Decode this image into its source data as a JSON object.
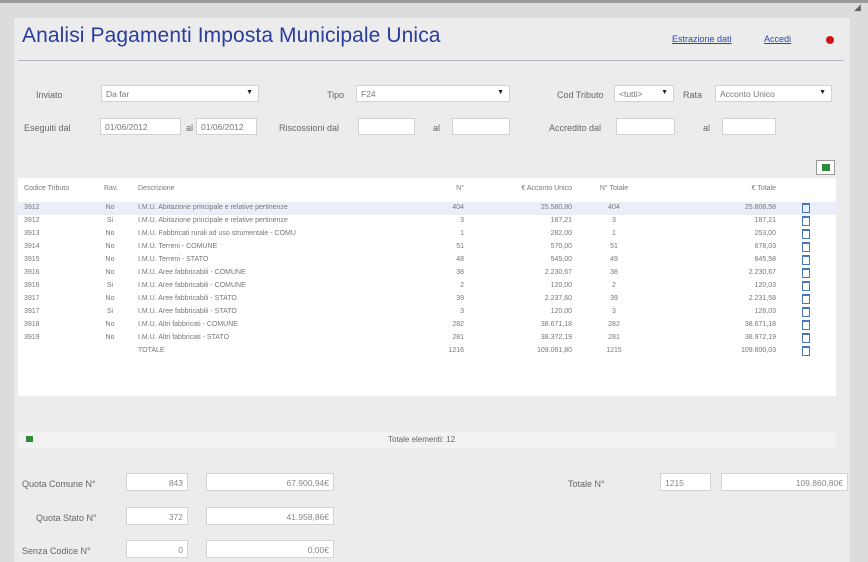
{
  "title": "Analisi Pagamenti Imposta Municipale Unica",
  "links": {
    "extract": "Estrazione dati",
    "back": "Accedi"
  },
  "filters": {
    "invento_label": "Inviato",
    "invento_value": "Da far",
    "tipo_label": "Tipo",
    "tipo_value": "F24",
    "cod_tributo_label": "Cod Tributo",
    "cod_tributo_value": "<tutti>",
    "rata_label": "Rata",
    "rata_value": "Acconto Unico",
    "eseguiti_label": "Eseguiti dal",
    "eseguiti_from": "01/06/2012",
    "al_label": "al",
    "eseguiti_to": "01/06/2012",
    "riscossioni_label": "Riscossioni dal",
    "riscossioni_al_label": "al",
    "accredito_label": "Accredito dal",
    "accredito_al_label": "al"
  },
  "table": {
    "headers": [
      "Codice Tributo",
      "Rav.",
      "Descrizione",
      "N°",
      "€ Acconto Unico",
      "N° Totale",
      "€ Totale"
    ],
    "rows": [
      [
        "3912",
        "No",
        "I.M.U. Abitazione principale e relative pertinenze",
        "404",
        "25.580,80",
        "404",
        "25.808,58"
      ],
      [
        "3912",
        "Si",
        "I.M.U. Abitazione principale e relative pertinenze",
        "3",
        "187,21",
        "3",
        "187,21"
      ],
      [
        "3913",
        "No",
        "I.M.U. Fabbricati rurali ad uso strumentale - COMU",
        "1",
        "282,00",
        "1",
        "253,00"
      ],
      [
        "3914",
        "No",
        "I.M.U. Terreni - COMUNE",
        "51",
        "570,00",
        "51",
        "678,03"
      ],
      [
        "3915",
        "No",
        "I.M.U. Terreni - STATO",
        "48",
        "545,00",
        "49",
        "845,58"
      ],
      [
        "3916",
        "No",
        "I.M.U. Aree fabbricabili - COMUNE",
        "38",
        "2.230,67",
        "38",
        "2.230,67"
      ],
      [
        "3916",
        "Si",
        "I.M.U. Aree fabbricabili - COMUNE",
        "2",
        "120,00",
        "2",
        "120,03"
      ],
      [
        "3917",
        "No",
        "I.M.U. Aree fabbricabili - STATO",
        "39",
        "2.237,60",
        "39",
        "2.231,58"
      ],
      [
        "3917",
        "Si",
        "I.M.U. Aree fabbricabili - STATO",
        "3",
        "120,00",
        "3",
        "126,03"
      ],
      [
        "3918",
        "No",
        "I.M.U. Altri fabbricati - COMUNE",
        "282",
        "38.671,18",
        "282",
        "38.671,18"
      ],
      [
        "3919",
        "No",
        "I.M.U. Altri fabbricati - STATO",
        "281",
        "38.372,19",
        "281",
        "38.972,19"
      ],
      [
        "",
        "",
        "TOTALE",
        "1216",
        "109.061,80",
        "1215",
        "109.800,03"
      ]
    ],
    "footer": "Totale elementi: 12"
  },
  "summary": {
    "quota_comune_label": "Quota Comune N°",
    "quota_comune_n": "843",
    "quota_comune_amount": "67.900,94€",
    "quota_stato_label": "Quota Stato N°",
    "quota_stato_n": "372",
    "quota_stato_amount": "41.958,86€",
    "senza_codice_label": "Senza Codice N°",
    "senza_codice_n": "0",
    "senza_codice_amount": "0,00€",
    "totale_label": "Totale N°",
    "totale_n": "1215",
    "totale_amount": "109.860,80€"
  },
  "colors": {
    "title": "#2a3c9c",
    "link": "#2846b4",
    "accent_red": "#d21414",
    "excel_green": "#2e8b3a"
  },
  "icons": [
    "excel-export-icon",
    "document-icon",
    "red-dot-icon"
  ]
}
